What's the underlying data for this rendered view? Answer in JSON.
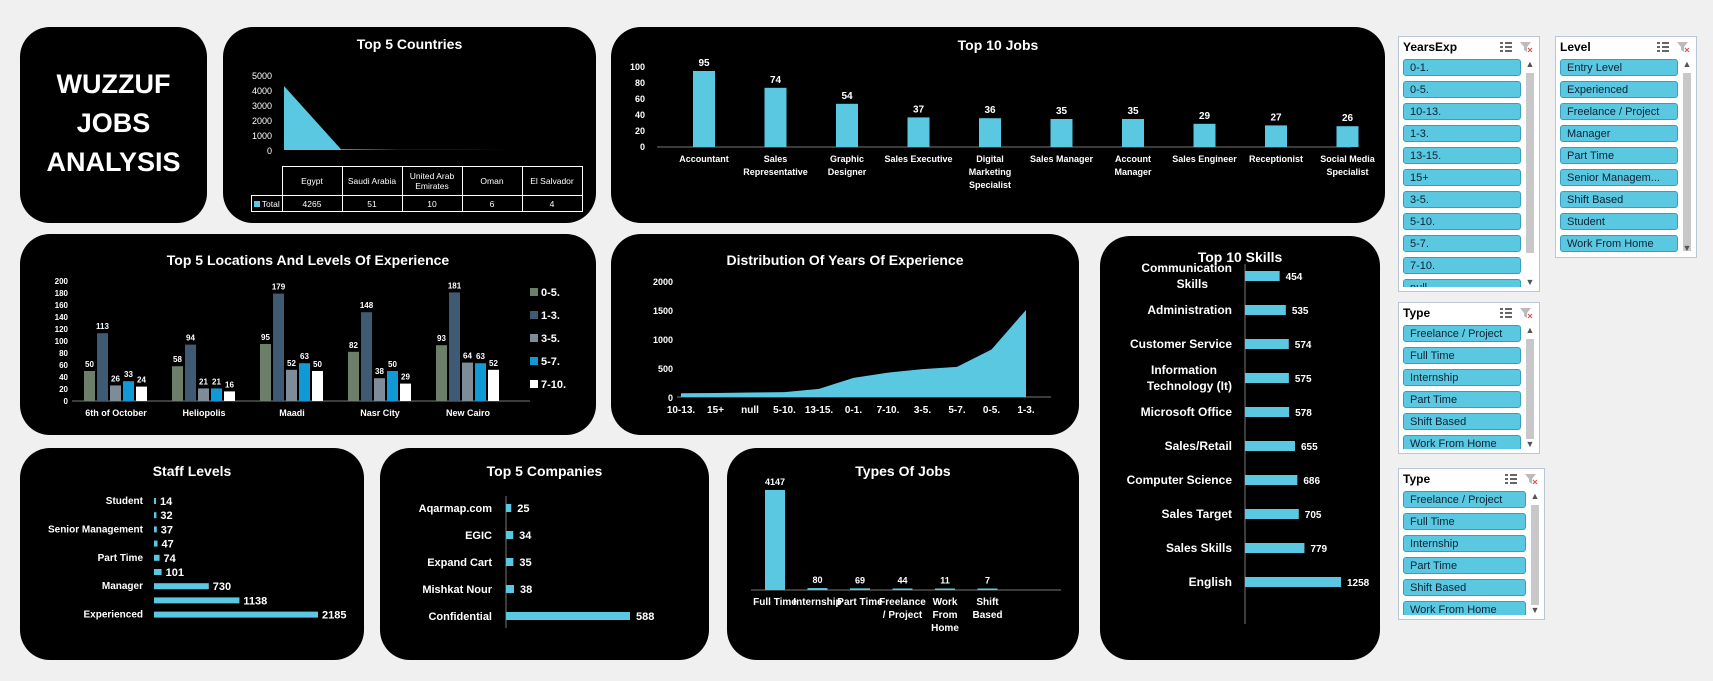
{
  "dashboard": {
    "title_lines": [
      "WUZZUF",
      "JOBS",
      "ANALYSIS"
    ]
  },
  "colors": {
    "accent": "#5bc8e2",
    "background": "#000000",
    "page": "#f0f0f0"
  },
  "top_countries": {
    "title": "Top 5 Countries",
    "y_ticks": [
      "5000",
      "4000",
      "3000",
      "2000",
      "1000",
      "0"
    ],
    "series_label": "Total",
    "columns": [
      "Egypt",
      "Saudi Arabia",
      "United Arab Emirates",
      "Oman",
      "El Salvador"
    ],
    "values_text": [
      "4265",
      "51",
      "10",
      "6",
      "4"
    ]
  },
  "top_jobs": {
    "title": "Top 10 Jobs",
    "y_ticks": [
      "100",
      "80",
      "60",
      "40",
      "20",
      "0"
    ]
  },
  "locations": {
    "title": "Top  5 Locations And Levels Of Experience",
    "y_ticks": [
      "200",
      "180",
      "160",
      "140",
      "120",
      "100",
      "80",
      "60",
      "40",
      "20",
      "0"
    ],
    "legend": [
      {
        "label": "0-5.",
        "color": "#6b7f6a"
      },
      {
        "label": "1-3.",
        "color": "#3f5a73"
      },
      {
        "label": "3-5.",
        "color": "#7e8b99"
      },
      {
        "label": "5-7.",
        "color": "#1199d6"
      },
      {
        "label": "7-10.",
        "color": "#ffffff"
      }
    ]
  },
  "distribution": {
    "title": "Distribution Of Years Of Experience",
    "y_ticks": [
      "2000",
      "1500",
      "1000",
      "500",
      "0"
    ]
  },
  "skills": {
    "title": "Top 10 Skills"
  },
  "staff": {
    "title": "Staff Levels"
  },
  "companies": {
    "title": "Top 5 Companies"
  },
  "types": {
    "title": "Types Of Jobs"
  },
  "chart_data": [
    {
      "type": "area",
      "title": "Top 5 Countries",
      "categories": [
        "Egypt",
        "Saudi Arabia",
        "United Arab Emirates",
        "Oman",
        "El Salvador"
      ],
      "series": [
        {
          "name": "Total",
          "values": [
            4265,
            51,
            10,
            6,
            4
          ]
        }
      ],
      "ylim": [
        0,
        5000
      ],
      "grid": false,
      "legend": "table"
    },
    {
      "type": "bar",
      "title": "Top 10 Jobs",
      "categories": [
        "Accountant",
        "Sales Representative",
        "Graphic Designer",
        "Sales Executive",
        "Digital Marketing Specialist",
        "Sales Manager",
        "Account Manager",
        "Sales Engineer",
        "Receptionist",
        "Social Media Specialist"
      ],
      "values": [
        95,
        74,
        54,
        37,
        36,
        35,
        35,
        29,
        27,
        26
      ],
      "ylim": [
        0,
        100
      ]
    },
    {
      "type": "bar",
      "title": "Top  5 Locations And Levels Of Experience",
      "categories": [
        "6th of October",
        "Heliopolis",
        "Maadi",
        "Nasr City",
        "New Cairo"
      ],
      "series": [
        {
          "name": "0-5.",
          "values": [
            50,
            58,
            95,
            82,
            93
          ]
        },
        {
          "name": "1-3.",
          "values": [
            113,
            94,
            179,
            148,
            181
          ]
        },
        {
          "name": "3-5.",
          "values": [
            26,
            21,
            52,
            38,
            64
          ]
        },
        {
          "name": "5-7.",
          "values": [
            33,
            21,
            63,
            50,
            63
          ]
        },
        {
          "name": "7-10.",
          "values": [
            24,
            16,
            50,
            29,
            52
          ]
        }
      ],
      "ylim": [
        0,
        200
      ],
      "legend": "right"
    },
    {
      "type": "area",
      "title": "Distribution Of Years Of Experience",
      "categories": [
        "10-13.",
        "15+",
        "null",
        "5-10.",
        "13-15.",
        "0-1.",
        "7-10.",
        "3-5.",
        "5-7.",
        "0-5.",
        "1-3."
      ],
      "values": [
        65,
        70,
        78,
        85,
        140,
        330,
        420,
        480,
        520,
        820,
        1500
      ],
      "ylim": [
        0,
        2000
      ]
    },
    {
      "type": "bar",
      "title": "Top 10 Skills",
      "orientation": "horizontal",
      "categories": [
        "Communication Skills",
        "Administration",
        "Customer Service",
        "Information Technology (It)",
        "Microsoft Office",
        "Sales/Retail",
        "Computer Science",
        "Sales Target",
        "Sales Skills",
        "English"
      ],
      "values": [
        454,
        535,
        574,
        575,
        578,
        655,
        686,
        705,
        779,
        1258
      ]
    },
    {
      "type": "bar",
      "title": "Staff Levels",
      "orientation": "horizontal",
      "labels": [
        "Student",
        "",
        "Senior Management",
        "",
        "Part Time",
        "",
        "Manager",
        "",
        "Experienced"
      ],
      "values": [
        14,
        32,
        37,
        47,
        74,
        101,
        730,
        1138,
        2185
      ]
    },
    {
      "type": "bar",
      "title": "Top 5 Companies",
      "orientation": "horizontal",
      "categories": [
        "Aqarmap.com",
        "EGIC",
        "Expand Cart",
        "Mishkat Nour",
        "Confidential"
      ],
      "values": [
        25,
        34,
        35,
        38,
        588
      ]
    },
    {
      "type": "bar",
      "title": "Types Of Jobs",
      "categories": [
        "Full Time",
        "Internship",
        "Part Time",
        "Freelance / Project",
        "Work From Home",
        "Shift Based"
      ],
      "values": [
        4147,
        80,
        69,
        44,
        11,
        7
      ]
    }
  ],
  "slicers": {
    "years_exp": {
      "header": "YearsExp",
      "items": [
        "0-1.",
        "0-5.",
        "10-13.",
        "1-3.",
        "13-15.",
        "15+",
        "3-5.",
        "5-10.",
        "5-7.",
        "7-10.",
        "null"
      ]
    },
    "level": {
      "header": "Level",
      "items": [
        "Entry Level",
        "Experienced",
        "Freelance / Project",
        "Manager",
        "Part Time",
        "Senior Managem...",
        "Shift Based",
        "Student",
        "Work From Home"
      ]
    },
    "type1": {
      "header": "Type",
      "items": [
        "Freelance / Project",
        "Full Time",
        "Internship",
        "Part Time",
        "Shift Based",
        "Work From Home"
      ]
    },
    "type2": {
      "header": "Type",
      "items": [
        "Freelance / Project",
        "Full Time",
        "Internship",
        "Part Time",
        "Shift Based",
        "Work From Home"
      ]
    }
  }
}
